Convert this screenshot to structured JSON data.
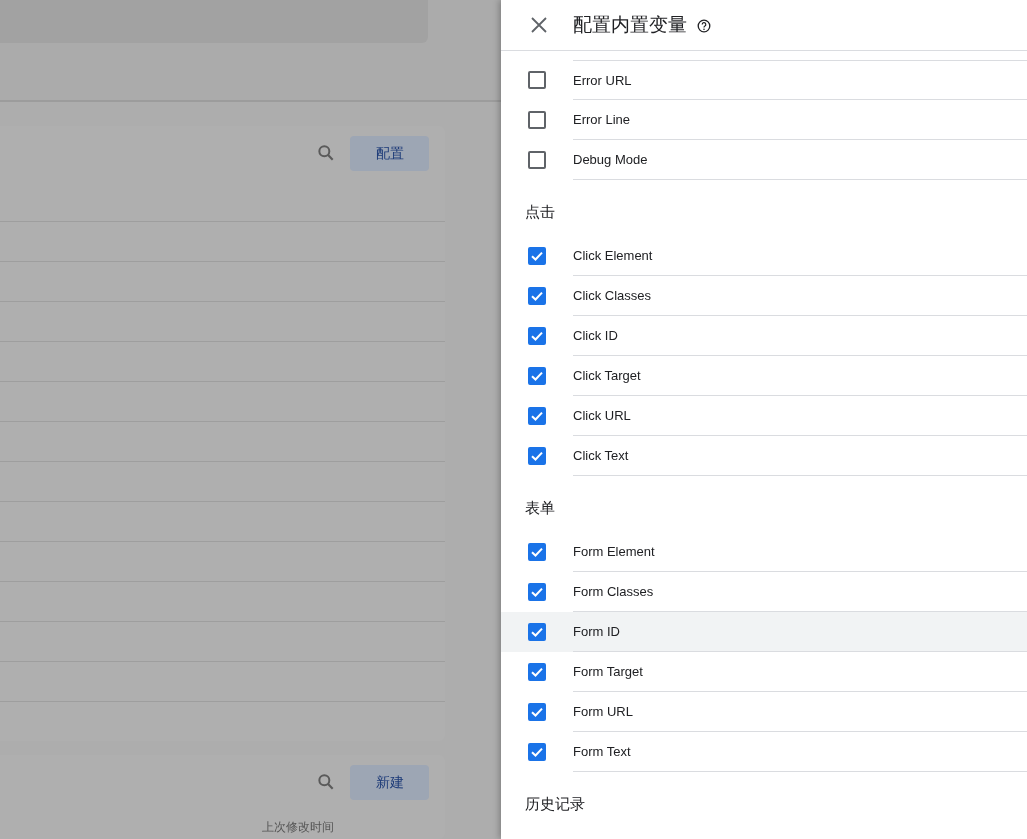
{
  "background_page": {
    "cards": [
      {
        "button": "配置"
      },
      {
        "button": "新建",
        "column_header": "上次修改时间"
      }
    ]
  },
  "dialog": {
    "title": "配置内置变量",
    "sections": [
      {
        "items": [
          {
            "label": "Error URL",
            "checked": false,
            "hovered": false
          },
          {
            "label": "Error Line",
            "checked": false,
            "hovered": false
          },
          {
            "label": "Debug Mode",
            "checked": false,
            "hovered": false
          }
        ]
      },
      {
        "heading": "点击",
        "items": [
          {
            "label": "Click Element",
            "checked": true,
            "hovered": false
          },
          {
            "label": "Click Classes",
            "checked": true,
            "hovered": false
          },
          {
            "label": "Click ID",
            "checked": true,
            "hovered": false
          },
          {
            "label": "Click Target",
            "checked": true,
            "hovered": false
          },
          {
            "label": "Click URL",
            "checked": true,
            "hovered": false
          },
          {
            "label": "Click Text",
            "checked": true,
            "hovered": false
          }
        ]
      },
      {
        "heading": "表单",
        "items": [
          {
            "label": "Form Element",
            "checked": true,
            "hovered": false
          },
          {
            "label": "Form Classes",
            "checked": true,
            "hovered": false
          },
          {
            "label": "Form ID",
            "checked": true,
            "hovered": true
          },
          {
            "label": "Form Target",
            "checked": true,
            "hovered": false
          },
          {
            "label": "Form URL",
            "checked": true,
            "hovered": false
          },
          {
            "label": "Form Text",
            "checked": true,
            "hovered": false
          }
        ]
      },
      {
        "heading": "历史记录"
      }
    ]
  }
}
